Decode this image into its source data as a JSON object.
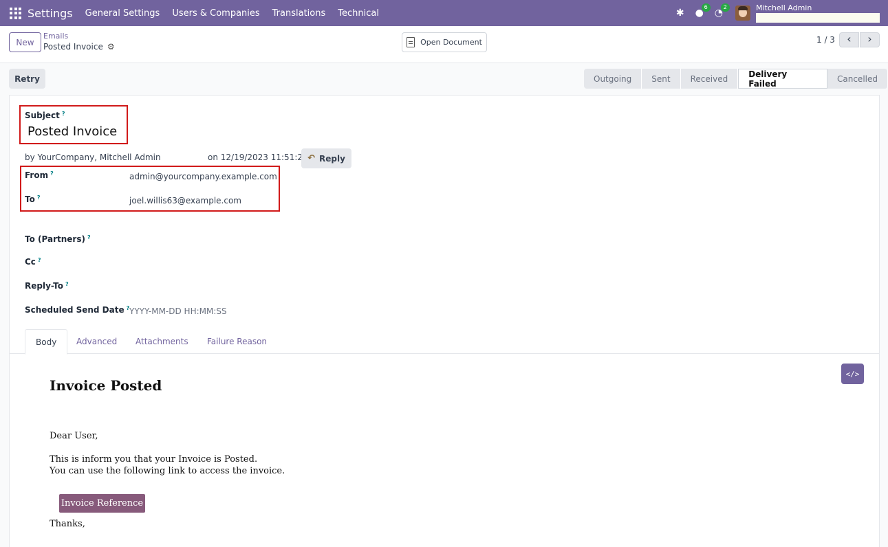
{
  "navbar": {
    "brand": "Settings",
    "menu": [
      "General Settings",
      "Users & Companies",
      "Translations",
      "Technical"
    ],
    "chat_count": "6",
    "activity_count": "2",
    "user_name": "Mitchell Admin"
  },
  "control_panel": {
    "new_label": "New",
    "breadcrumb_parent": "Emails",
    "breadcrumb_current": "Posted Invoice",
    "open_document_label": "Open Document",
    "pager": "1 / 3"
  },
  "statusbar": {
    "retry_label": "Retry",
    "stages": [
      "Outgoing",
      "Sent",
      "Received",
      "Delivery Failed",
      "Cancelled"
    ],
    "active_stage": "Delivery Failed"
  },
  "form": {
    "subject_label": "Subject",
    "subject_value": "Posted Invoice",
    "by_text": "by  YourCompany, Mitchell Admin",
    "date_text": "on 12/19/2023 11:51:24",
    "reply_label": "Reply",
    "from_label": "From",
    "from_value": "admin@yourcompany.example.com",
    "to_label": "To",
    "to_value": "joel.willis63@example.com",
    "to_partners_label": "To (Partners)",
    "cc_label": "Cc",
    "reply_to_label": "Reply-To",
    "scheduled_label": "Scheduled Send Date",
    "scheduled_placeholder": "YYYY-MM-DD HH:MM:SS",
    "help_mark": "?"
  },
  "tabs": [
    "Body",
    "Advanced",
    "Attachments",
    "Failure Reason"
  ],
  "body": {
    "title": "Invoice Posted",
    "greeting": "Dear User,",
    "line1": "This is inform you that your Invoice is Posted.",
    "line2": "You can use the following link to access the invoice.",
    "button_label": "Invoice Reference",
    "closing": "Thanks,"
  },
  "colors": {
    "brand": "#71639e",
    "highlight": "#d11a1a",
    "invoice_button": "#875a7b"
  }
}
